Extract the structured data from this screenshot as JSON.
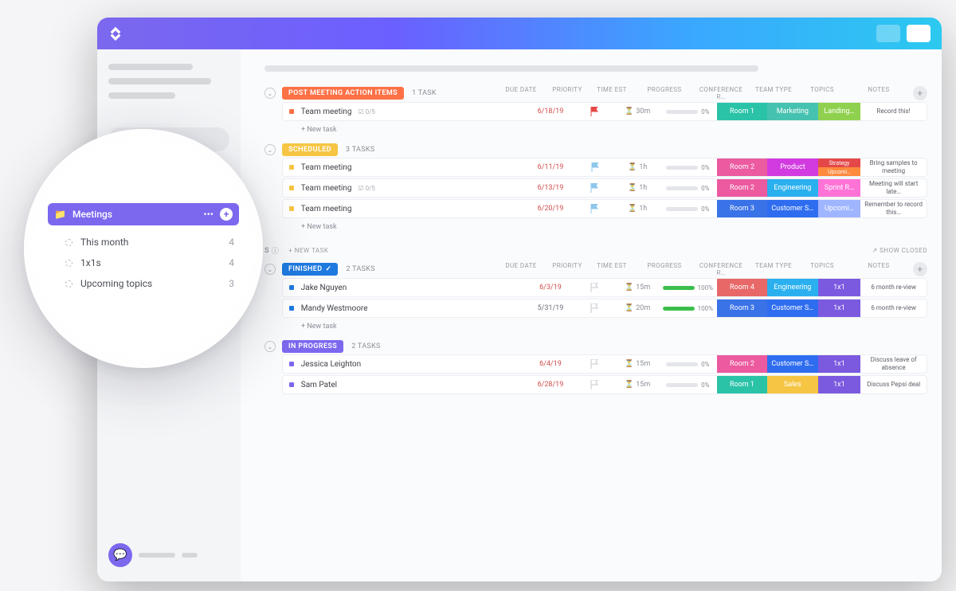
{
  "columns": {
    "due": "DUE DATE",
    "priority": "PRIORITY",
    "time": "TIME EST",
    "progress": "PROGRESS",
    "conf": "CONFERENCE R…",
    "team": "TEAM TYPE",
    "topics": "TOPICS",
    "notes": "NOTES"
  },
  "new_task": "+ New task",
  "show_closed": "↗ SHOW CLOSED",
  "section_new_task": "+ NEW TASK",
  "floating": {
    "folder_label": "Meetings",
    "items": [
      {
        "label": "This month",
        "count": "4"
      },
      {
        "label": "1x1s",
        "count": "4"
      },
      {
        "label": "Upcoming topics",
        "count": "3"
      }
    ]
  },
  "groups": [
    {
      "status": "POST MEETING ACTION ITEMS",
      "status_color": "#fd7146",
      "count": "1 TASK",
      "show_cols": true,
      "rows": [
        {
          "bullet": "#fd7146",
          "title": "Team meeting",
          "sub": "0/5",
          "due": "6/18/19",
          "due_gray": false,
          "flag": "#e64848",
          "flag_fill": true,
          "time": "30m",
          "prog": 0,
          "prog_color": "#74d57c",
          "conf": "Room 1",
          "conf_bg": "#2bc3a8",
          "team": "Marketing",
          "team_bg": "#46c2b0",
          "topics": [
            {
              "t": "Landing…",
              "bg": "#8fd14f"
            }
          ],
          "note": "Record this!"
        }
      ]
    },
    {
      "status": "SCHEDULED",
      "status_color": "#f5c543",
      "count": "3 TASKS",
      "show_cols": false,
      "rows": [
        {
          "bullet": "#f5c543",
          "title": "Team meeting",
          "sub": "",
          "due": "6/11/19",
          "due_gray": false,
          "flag": "#8fc7ec",
          "flag_fill": true,
          "time": "1h",
          "prog": 0,
          "prog_color": "#74d57c",
          "conf": "Room 2",
          "conf_bg": "#ec5aa0",
          "team": "Product",
          "team_bg": "#d13be0",
          "topics": [
            {
              "t": "Strategy",
              "bg": "#e44747"
            },
            {
              "t": "Upcomi…",
              "bg": "#ff8a3d"
            }
          ],
          "note": "Bring samples to meeting"
        },
        {
          "bullet": "#f5c543",
          "title": "Team meeting",
          "sub": "0/5",
          "due": "6/13/19",
          "due_gray": false,
          "flag": "#8fc7ec",
          "flag_fill": true,
          "time": "1h",
          "prog": 0,
          "prog_color": "#74d57c",
          "conf": "Room 2",
          "conf_bg": "#ec5aa0",
          "team": "Engineering",
          "team_bg": "#2bb0ef",
          "topics": [
            {
              "t": "Sprint R…",
              "bg": "#ff73d7"
            }
          ],
          "note": "Meeting will start late…"
        },
        {
          "bullet": "#f5c543",
          "title": "Team meeting",
          "sub": "",
          "due": "6/20/19",
          "due_gray": false,
          "flag": "#8fc7ec",
          "flag_fill": true,
          "time": "1h",
          "prog": 0,
          "prog_color": "#74d57c",
          "conf": "Room 3",
          "conf_bg": "#3a72e8",
          "team": "Customer S…",
          "team_bg": "#2f6df0",
          "topics": [
            {
              "t": "Upcomi…",
              "bg": "#9fb5ff"
            }
          ],
          "note": "Remember to record this…"
        }
      ]
    },
    {
      "status": "FINISHED",
      "status_color": "#1f7ae0",
      "count": "2 TASKS",
      "show_cols": true,
      "check": true,
      "rows": [
        {
          "bullet": "#1f7ae0",
          "title": "Jake Nguyen",
          "sub": "",
          "due": "6/3/19",
          "due_gray": false,
          "flag": "#c6c8cf",
          "flag_fill": false,
          "time": "15m",
          "prog": 100,
          "prog_color": "#3bbf4a",
          "conf": "Room 4",
          "conf_bg": "#e86868",
          "team": "Engineering",
          "team_bg": "#2bb0ef",
          "topics": [
            {
              "t": "1x1",
              "bg": "#7b5ae0"
            }
          ],
          "note": "6 month re-view"
        },
        {
          "bullet": "#1f7ae0",
          "title": "Mandy Westmoore",
          "sub": "",
          "due": "5/31/19",
          "due_gray": true,
          "flag": "#c6c8cf",
          "flag_fill": false,
          "time": "20m",
          "prog": 100,
          "prog_color": "#3bbf4a",
          "conf": "Room 3",
          "conf_bg": "#3a72e8",
          "team": "Customer S…",
          "team_bg": "#2f6df0",
          "topics": [
            {
              "t": "1x1",
              "bg": "#7b5ae0"
            }
          ],
          "note": "6 month re-view"
        }
      ]
    },
    {
      "status": "IN PROGRESS",
      "status_color": "#7b68ee",
      "count": "2 TASKS",
      "show_cols": false,
      "rows": [
        {
          "bullet": "#7b68ee",
          "title": "Jessica Leighton",
          "sub": "",
          "due": "6/4/19",
          "due_gray": false,
          "flag": "#c6c8cf",
          "flag_fill": false,
          "time": "15m",
          "prog": 0,
          "prog_color": "#74d57c",
          "conf": "Room 2",
          "conf_bg": "#ec5aa0",
          "team": "Customer S…",
          "team_bg": "#2f6df0",
          "topics": [
            {
              "t": "1x1",
              "bg": "#7b5ae0"
            }
          ],
          "note": "Discuss leave of absence"
        },
        {
          "bullet": "#7b68ee",
          "title": "Sam Patel",
          "sub": "",
          "due": "6/28/19",
          "due_gray": false,
          "flag": "#c6c8cf",
          "flag_fill": false,
          "time": "15m",
          "prog": 0,
          "prog_color": "#74d57c",
          "conf": "Room 1",
          "conf_bg": "#2bc3a8",
          "team": "Sales",
          "team_bg": "#f5c543",
          "topics": [
            {
              "t": "1x1",
              "bg": "#7b5ae0"
            }
          ],
          "note": "Discuss Pepsi deal"
        }
      ]
    }
  ]
}
